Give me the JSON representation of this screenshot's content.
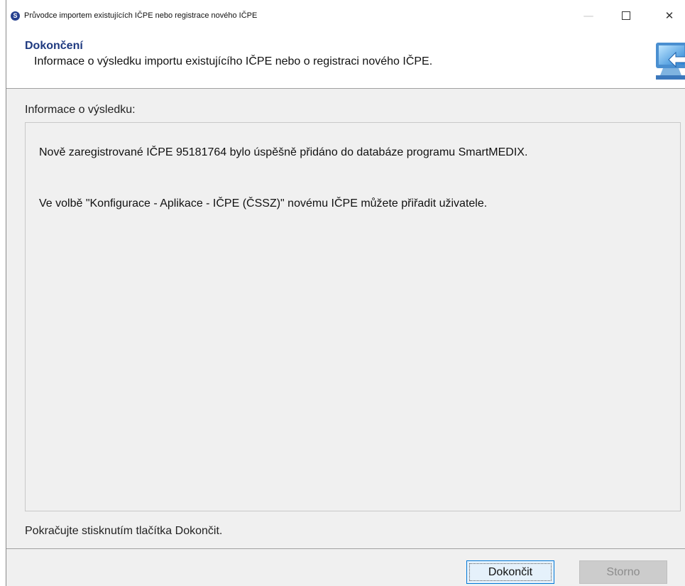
{
  "window": {
    "title": "Průvodce importem existujících IČPE nebo registrace nového IČPE",
    "app_icon_letter": "S",
    "controls": {
      "minimize": "—",
      "close": "✕"
    }
  },
  "header": {
    "title": "Dokončení",
    "subtitle": "Informace o výsledku importu existujícího IČPE nebo o registraci nového IČPE."
  },
  "main": {
    "section_label": "Informace o výsledku:",
    "result_messages": [
      "Nově zaregistrované IČPE 95181764 bylo úspěšně přidáno do databáze programu SmartMEDIX.",
      "Ve volbě \"Konfigurace - Aplikace - IČPE (ČSSZ)\" novému IČPE můžete přiřadit uživatele."
    ]
  },
  "footer": {
    "hint": "Pokračujte stisknutím tlačítka Dokončit.",
    "finish_label": "Dokončit",
    "cancel_label": "Storno"
  },
  "colors": {
    "header_title": "#1f3a80",
    "accent_border": "#0078d7",
    "window_bg": "#f0f0f0"
  },
  "icons": [
    "app-logo-icon",
    "wizard-computer-arrow-icon",
    "minimize-icon",
    "maximize-icon",
    "close-icon"
  ]
}
